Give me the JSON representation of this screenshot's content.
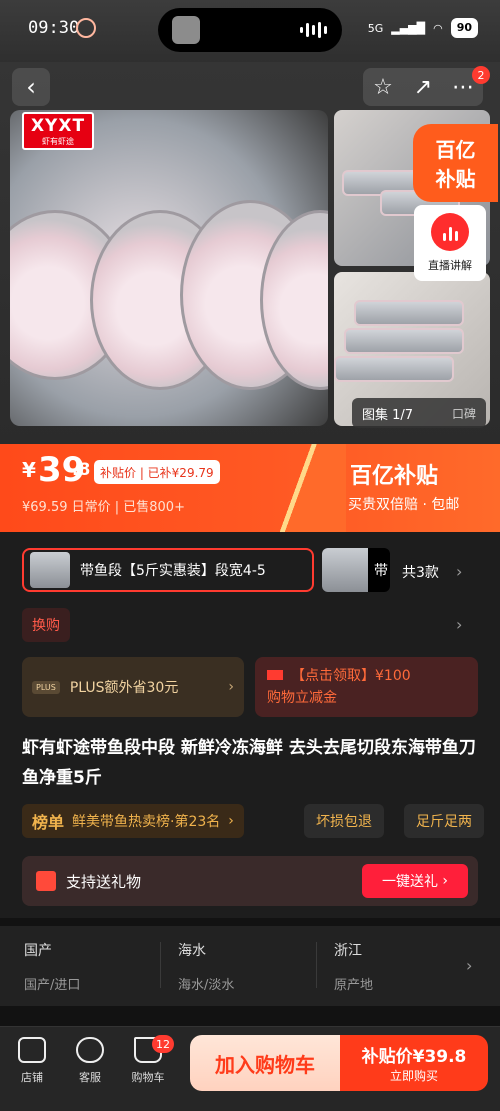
{
  "status": {
    "time": "09:30",
    "network": "5G",
    "battery": "90"
  },
  "gallery": {
    "logo_text": "XYXT",
    "logo_sub": "虾有虾途",
    "counter": "图集 1/7",
    "code_label": "口碑",
    "subsidy_badge_top": "百亿",
    "subsidy_badge_bottom": "补贴",
    "live_label": "直播讲解",
    "more_badge": "2"
  },
  "price": {
    "currency": "¥",
    "integer": "39",
    "decimal": ".8",
    "tag": "补贴价 | 已补¥29.79",
    "daily": "¥69.59 日常价 | 已售800+",
    "brand_title": "百亿补贴",
    "brand_sub": "买贵双倍赔 · 包邮"
  },
  "variant": {
    "selected": "带鱼段【5斤实惠装】段宽4-5",
    "other_label": "带",
    "total": "共3款"
  },
  "exchange_label": "换购",
  "plus": {
    "badge": "PLUS",
    "text": "PLUS额外省30元"
  },
  "coupon": {
    "line1": "【点击领取】¥100",
    "line2": "购物立减金"
  },
  "product_title": "虾有虾途带鱼段中段 新鲜冷冻海鲜 去头去尾切段东海带鱼刀鱼净重5斤",
  "rank": {
    "label": "榜单",
    "text": "鲜美带鱼热卖榜·第23名"
  },
  "pills": [
    "坏损包退",
    "足斤足两"
  ],
  "gift": {
    "text": "支持送礼物",
    "button": "一键送礼"
  },
  "attributes": [
    {
      "value": "国产",
      "key": "国产/进口"
    },
    {
      "value": "海水",
      "key": "海水/淡水"
    },
    {
      "value": "浙江",
      "key": "原产地"
    }
  ],
  "bottom": {
    "shop": "店铺",
    "service": "客服",
    "cart": "购物车",
    "cart_count": "12",
    "add_cart": "加入购物车",
    "buy_price": "补贴价¥39.8",
    "buy_label": "立即购买"
  },
  "colors": {
    "accent": "#ff3b1a",
    "bg": "#1d1d1d"
  }
}
